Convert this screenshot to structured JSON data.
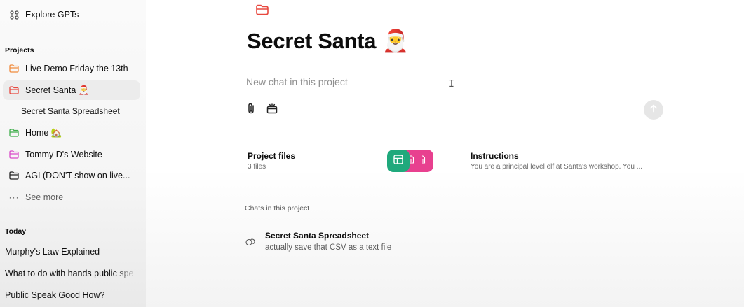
{
  "sidebar": {
    "explore_label": "Explore GPTs",
    "projects_heading": "Projects",
    "projects": [
      {
        "label": "Live Demo Friday the 13th",
        "color": "#f08a3c"
      },
      {
        "label": "Secret Santa 🎅",
        "color": "#e8483f"
      },
      {
        "label": "Home 🏡",
        "color": "#3fae4b"
      },
      {
        "label": "Tommy D's Website",
        "color": "#d94ac9"
      },
      {
        "label": "AGI (DON'T show on live...",
        "color": "#222222"
      }
    ],
    "subchat": "Secret Santa Spreadsheet",
    "see_more": "See more",
    "today_heading": "Today",
    "today": [
      "Murphy's Law Explained",
      "What to do with hands public spe",
      "Public Speak Good How?"
    ]
  },
  "main": {
    "title": "Secret Santa 🎅",
    "composer": {
      "placeholder": "New chat in this project"
    },
    "project_files": {
      "label": "Project files",
      "count": "3 files"
    },
    "instructions": {
      "label": "Instructions",
      "preview": "You are a principal level elf at Santa's workshop. You ..."
    },
    "chats_heading": "Chats in this project",
    "chats": [
      {
        "title": "Secret Santa Spreadsheet",
        "preview": "actually save that CSV as a text file"
      }
    ]
  },
  "colors": {
    "spreadsheet_chip": "#1fa97c",
    "doc_chip": "#e8408f",
    "accent_folder": "#e8483f"
  },
  "icons": [
    "grid-icon",
    "folder-icon",
    "dots-icon",
    "paperclip-icon",
    "tools-icon",
    "send-arrow-icon",
    "spreadsheet-icon",
    "document-icon",
    "chat-bubbles-icon"
  ]
}
